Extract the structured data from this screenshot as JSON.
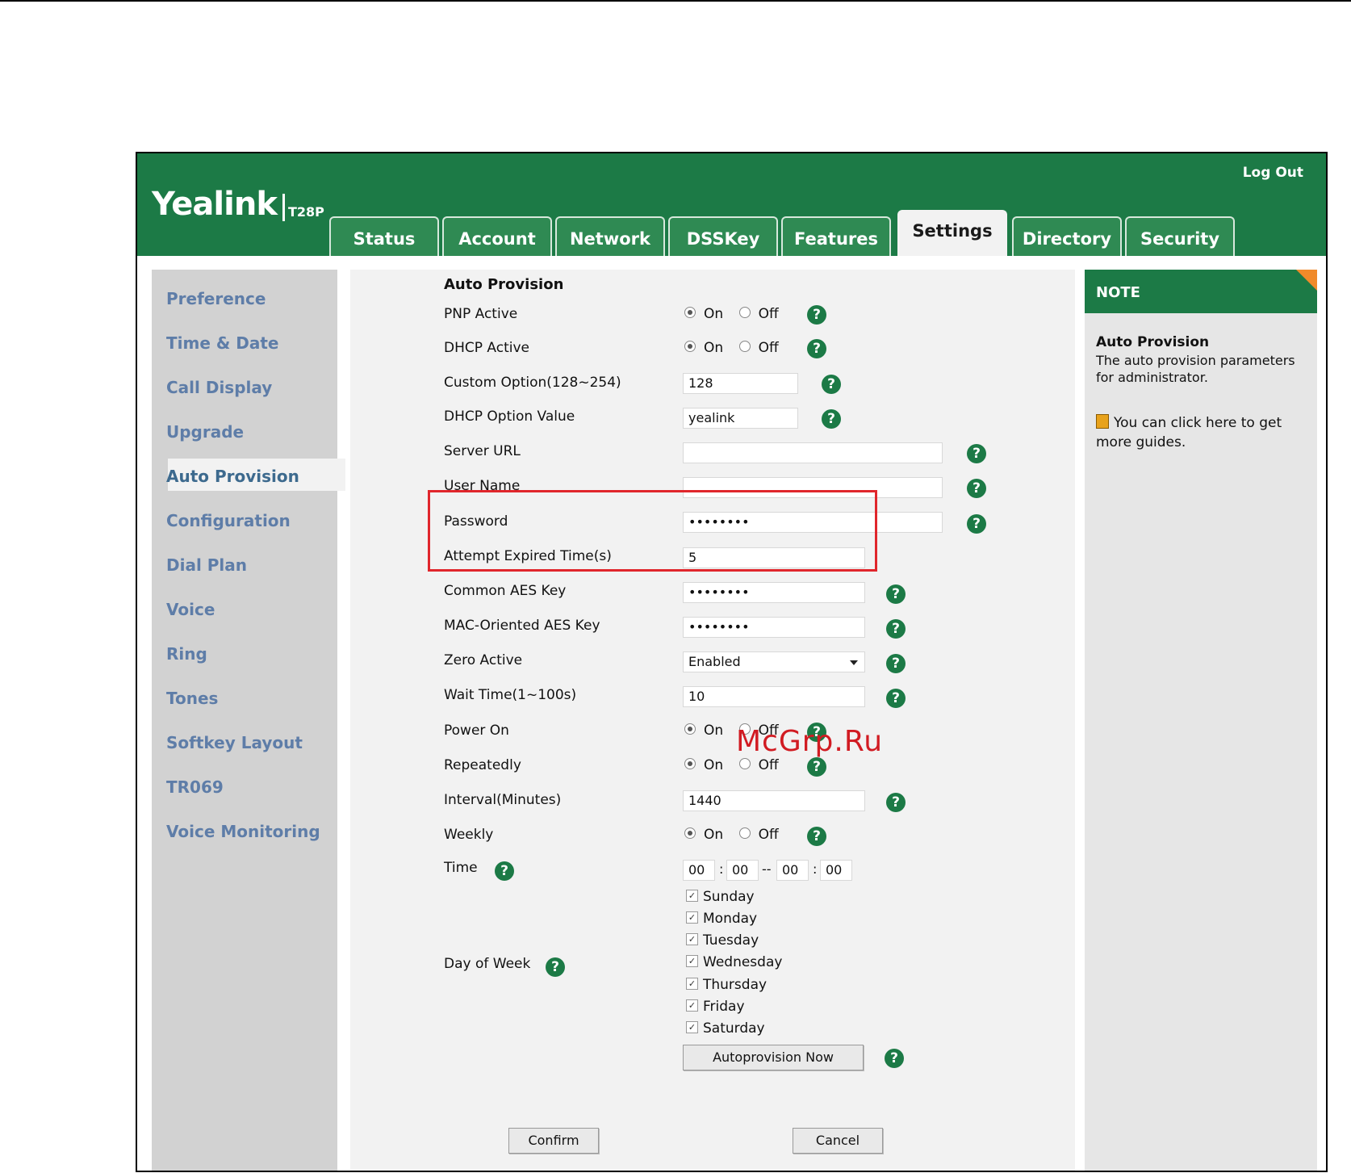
{
  "header": {
    "logo": "Yealink",
    "model": "T28P",
    "logout": "Log Out"
  },
  "tabs": [
    {
      "label": "Status"
    },
    {
      "label": "Account"
    },
    {
      "label": "Network"
    },
    {
      "label": "DSSKey"
    },
    {
      "label": "Features"
    },
    {
      "label": "Settings",
      "active": true
    },
    {
      "label": "Directory"
    },
    {
      "label": "Security"
    }
  ],
  "sidebar": {
    "items": [
      {
        "label": "Preference"
      },
      {
        "label": "Time & Date"
      },
      {
        "label": "Call Display"
      },
      {
        "label": "Upgrade"
      },
      {
        "label": "Auto Provision",
        "active": true
      },
      {
        "label": "Configuration"
      },
      {
        "label": "Dial Plan"
      },
      {
        "label": "Voice"
      },
      {
        "label": "Ring"
      },
      {
        "label": "Tones"
      },
      {
        "label": "Softkey Layout"
      },
      {
        "label": "TR069"
      },
      {
        "label": "Voice Monitoring"
      }
    ]
  },
  "form": {
    "section_title": "Auto Provision",
    "radio_on": "On",
    "radio_off": "Off",
    "help_glyph": "?",
    "pnp_active": {
      "label": "PNP Active",
      "value": "On"
    },
    "dhcp_active": {
      "label": "DHCP Active",
      "value": "On"
    },
    "custom_option": {
      "label": "Custom Option(128~254)",
      "value": "128"
    },
    "dhcp_option_value": {
      "label": "DHCP Option Value",
      "value": "yealink"
    },
    "server_url": {
      "label": "Server URL",
      "value": ""
    },
    "user_name": {
      "label": "User Name",
      "value": ""
    },
    "password": {
      "label": "Password",
      "value": "••••••••"
    },
    "attempt_expired": {
      "label": "Attempt Expired Time(s)",
      "value": "5"
    },
    "common_aes": {
      "label": "Common AES Key",
      "value": "••••••••"
    },
    "mac_aes": {
      "label": "MAC-Oriented AES Key",
      "value": "••••••••"
    },
    "zero_active": {
      "label": "Zero Active",
      "value": "Enabled"
    },
    "wait_time": {
      "label": "Wait Time(1~100s)",
      "value": "10"
    },
    "power_on": {
      "label": "Power On",
      "value": "On"
    },
    "repeatedly": {
      "label": "Repeatedly",
      "value": "On"
    },
    "interval": {
      "label": "Interval(Minutes)",
      "value": "1440"
    },
    "weekly": {
      "label": "Weekly",
      "value": "On"
    },
    "time": {
      "label": "Time",
      "h1": "00",
      "m1": "00",
      "h2": "00",
      "m2": "00",
      "sep_colon": ":",
      "sep_dash": "--"
    },
    "day_of_week": {
      "label": "Day of Week",
      "check_glyph": "✓",
      "days": [
        "Sunday",
        "Monday",
        "Tuesday",
        "Wednesday",
        "Thursday",
        "Friday",
        "Saturday"
      ]
    },
    "autoprovision_now": "Autoprovision Now",
    "confirm": "Confirm",
    "cancel": "Cancel"
  },
  "note": {
    "title": "NOTE",
    "body_title": "Auto Provision",
    "body": "The auto provision parameters for administrator.",
    "link": "You can click here to get more guides."
  },
  "watermark": "McGrp.Ru",
  "colors": {
    "header_green": "#1c7a46",
    "sidebar_text": "#5e7da8",
    "highlight_red": "#e0262c",
    "note_corner": "#f08a2a"
  }
}
